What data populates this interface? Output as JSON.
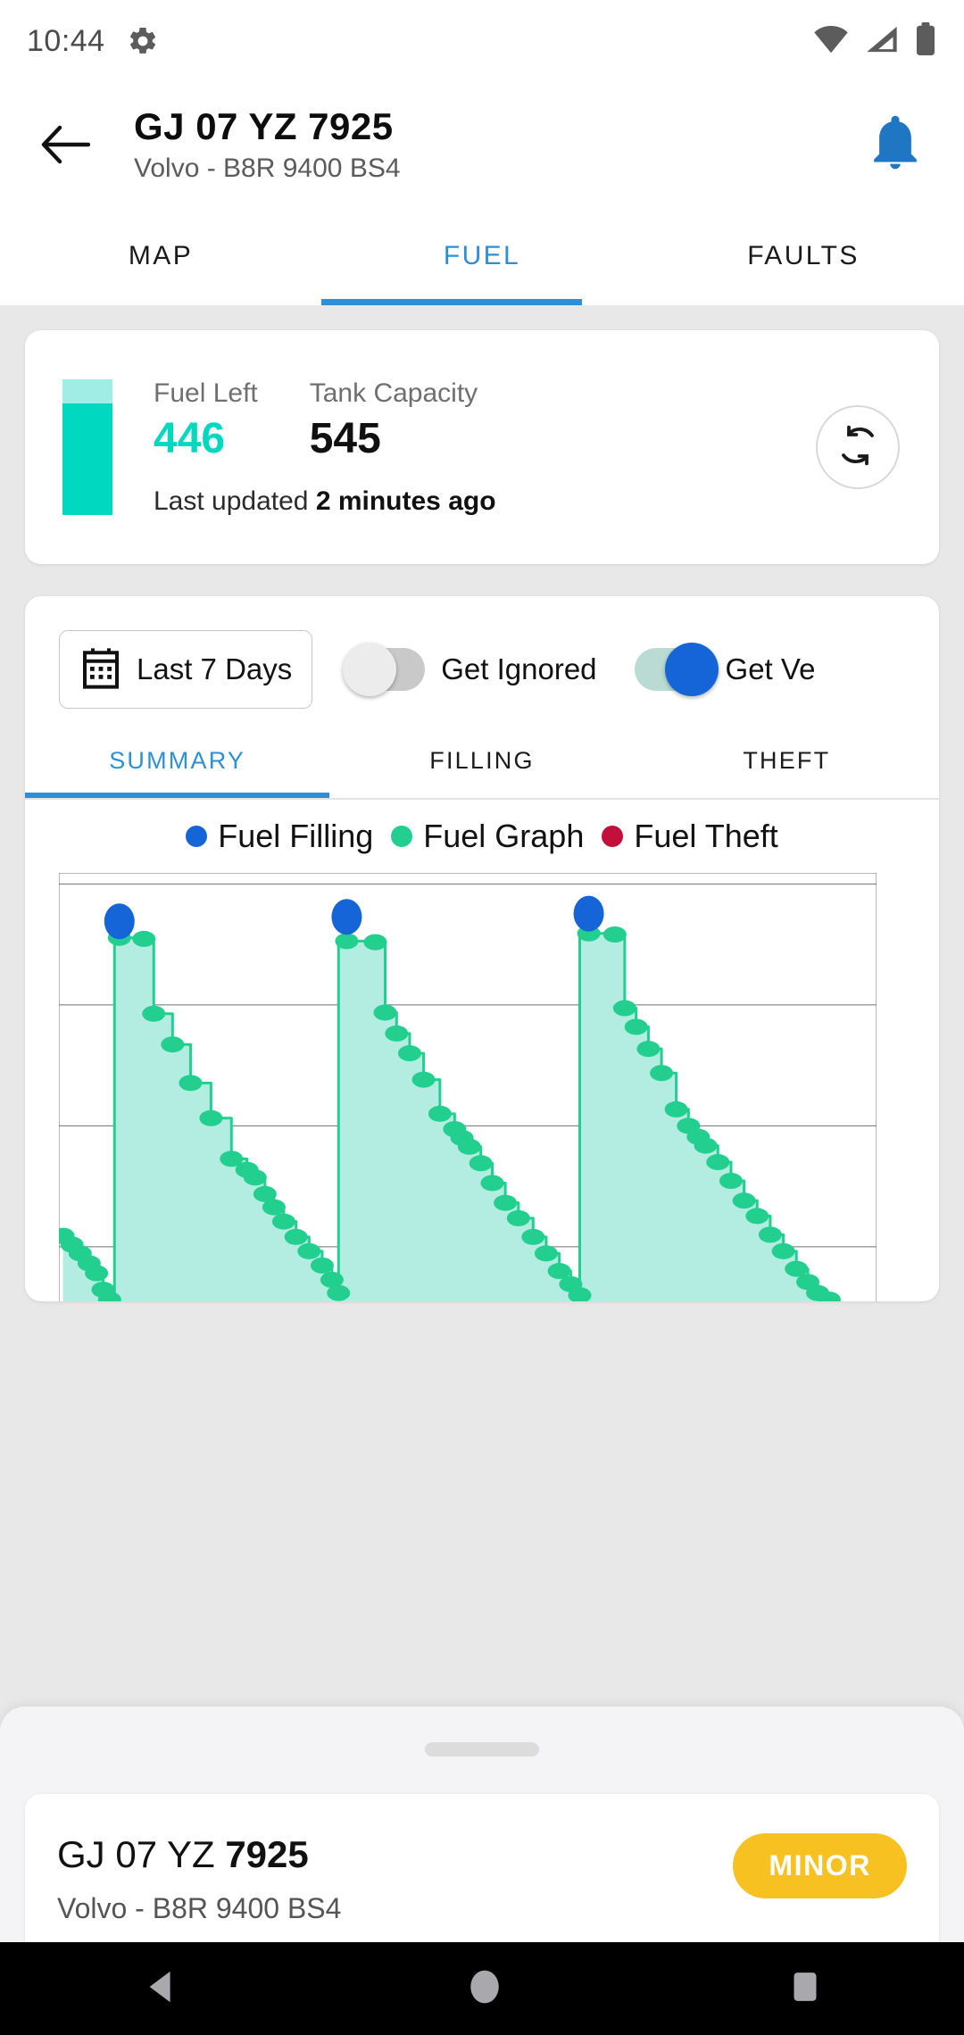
{
  "status_bar": {
    "time": "10:44",
    "gear_icon": "gear-icon",
    "wifi_icon": "wifi-icon",
    "signal_icon": "cellular-signal-icon",
    "battery_icon": "battery-icon"
  },
  "app_bar": {
    "back_icon": "back-arrow-icon",
    "title": "GJ 07 YZ 7925",
    "subtitle": "Volvo - B8R 9400 BS4",
    "notification_icon": "bell-icon"
  },
  "main_tabs": {
    "items": [
      {
        "label": "MAP",
        "active": false
      },
      {
        "label": "FUEL",
        "active": true
      },
      {
        "label": "FAULTS",
        "active": false
      }
    ],
    "active_color": "#2d8fd5"
  },
  "fuel_card": {
    "gauge": {
      "icon": "fuel-gauge-icon",
      "fill_percent": 82,
      "fill_color": "#00D8C0",
      "empty_color": "#9FEDE5"
    },
    "fuel_left_label": "Fuel Left",
    "fuel_left_value": "446",
    "tank_capacity_label": "Tank Capacity",
    "tank_capacity_value": "545",
    "last_updated_prefix": "Last updated",
    "last_updated_value": "2 minutes ago",
    "refresh_icon": "refresh-icon"
  },
  "filters": {
    "date_range_icon": "calendar-icon",
    "date_range_label": "Last 7 Days",
    "toggles": [
      {
        "label": "Get Ignored",
        "on": false
      },
      {
        "label": "Get Ve",
        "on": true
      }
    ]
  },
  "sub_tabs": {
    "items": [
      {
        "label": "SUMMARY",
        "active": true
      },
      {
        "label": "FILLING",
        "active": false
      },
      {
        "label": "THEFT",
        "active": false
      }
    ]
  },
  "chart_data": {
    "type": "line",
    "title": "",
    "xlabel": "",
    "ylabel": "",
    "grid": true,
    "legend_position": "top",
    "legend": [
      {
        "name": "Fuel Filling",
        "color": "#1565d8"
      },
      {
        "name": "Fuel Graph",
        "color": "#23cf8f"
      },
      {
        "name": "Fuel Theft",
        "color": "#c2103a"
      }
    ],
    "ylim": [
      0,
      560
    ],
    "xlim": [
      0,
      100
    ],
    "gridlines_y": [
      110,
      220,
      330,
      440,
      550
    ],
    "series": [
      {
        "name": "Fuel Graph",
        "color": "#23cf8f",
        "fill_color": "#b3ece0",
        "points": [
          [
            0.5,
            230
          ],
          [
            1.6,
            222
          ],
          [
            2.6,
            214
          ],
          [
            3.7,
            205
          ],
          [
            4.6,
            196
          ],
          [
            5.4,
            181
          ],
          [
            6.2,
            172
          ],
          [
            6.8,
            164
          ],
          [
            7.4,
            501
          ],
          [
            10.4,
            500
          ],
          [
            11.6,
            432
          ],
          [
            13.9,
            404
          ],
          [
            16.1,
            369
          ],
          [
            18.6,
            337
          ],
          [
            21.1,
            300
          ],
          [
            23.0,
            290
          ],
          [
            24.0,
            283
          ],
          [
            25.2,
            268
          ],
          [
            26.3,
            256
          ],
          [
            27.5,
            243
          ],
          [
            29.0,
            229
          ],
          [
            30.6,
            216
          ],
          [
            32.2,
            203
          ],
          [
            33.4,
            190
          ],
          [
            34.2,
            178
          ],
          [
            35.2,
            498
          ],
          [
            38.7,
            497
          ],
          [
            39.9,
            433
          ],
          [
            41.3,
            414
          ],
          [
            42.9,
            396
          ],
          [
            44.6,
            372
          ],
          [
            46.6,
            341
          ],
          [
            48.4,
            327
          ],
          [
            49.3,
            319
          ],
          [
            50.2,
            311
          ],
          [
            51.6,
            296
          ],
          [
            53.0,
            278
          ],
          [
            54.6,
            260
          ],
          [
            56.2,
            246
          ],
          [
            58.0,
            229
          ],
          [
            59.6,
            214
          ],
          [
            61.2,
            198
          ],
          [
            62.6,
            186
          ],
          [
            63.7,
            176
          ],
          [
            64.8,
            505
          ],
          [
            68.0,
            504
          ],
          [
            69.2,
            437
          ],
          [
            70.6,
            420
          ],
          [
            72.1,
            400
          ],
          [
            73.7,
            378
          ],
          [
            75.5,
            345
          ],
          [
            77.0,
            330
          ],
          [
            78.2,
            320
          ],
          [
            79.1,
            312
          ],
          [
            80.6,
            297
          ],
          [
            82.2,
            280
          ],
          [
            83.8,
            262
          ],
          [
            85.4,
            248
          ],
          [
            87.0,
            231
          ],
          [
            88.6,
            216
          ],
          [
            90.2,
            200
          ],
          [
            91.6,
            188
          ],
          [
            92.8,
            178
          ],
          [
            94.2,
            172
          ]
        ]
      }
    ],
    "events": [
      {
        "type": "Fuel Filling",
        "x": 7.4,
        "y": 516,
        "color": "#1565d8"
      },
      {
        "type": "Fuel Filling",
        "x": 35.2,
        "y": 520,
        "color": "#1565d8"
      },
      {
        "type": "Fuel Filling",
        "x": 64.8,
        "y": 523,
        "color": "#1565d8"
      }
    ]
  },
  "bottom_sheet": {
    "handle": "drag-handle",
    "plate_prefix": "GJ 07 YZ ",
    "plate_number": "7925",
    "vehicle_model": "Volvo - B8R 9400 BS4",
    "badge_label": "MINOR",
    "badge_color": "#F7C221"
  },
  "nav_bar": {
    "back_icon": "nav-back-icon",
    "home_icon": "nav-home-icon",
    "recents_icon": "nav-recents-icon"
  }
}
